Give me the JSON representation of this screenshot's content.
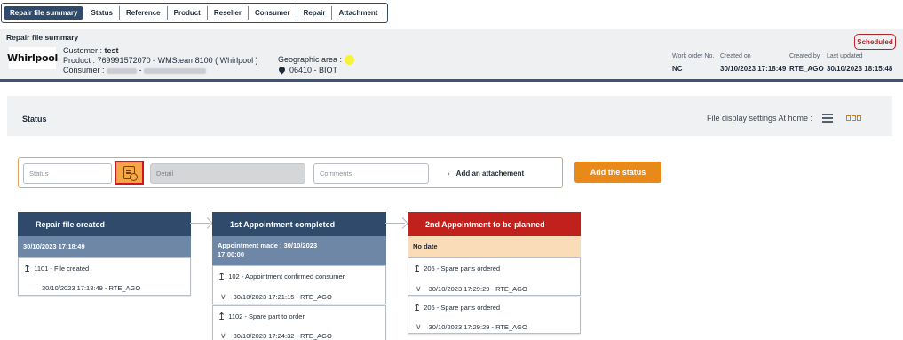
{
  "tabs": [
    {
      "label": "Repair file summary",
      "active": true
    },
    {
      "label": "Status"
    },
    {
      "label": "Reference"
    },
    {
      "label": "Product"
    },
    {
      "label": "Reseller"
    },
    {
      "label": "Consumer"
    },
    {
      "label": "Repair"
    },
    {
      "label": "Attachment"
    }
  ],
  "header": {
    "title": "Repair file summary",
    "brand": "Whirlpool",
    "customer_label": "Customer : ",
    "customer_value": "test",
    "product_label": "Product : ",
    "product_value": "769991572070  -  WMSteam8100 ( Whirlpool )",
    "consumer_label": "Consumer : ",
    "geo_label": "Geographic area :",
    "geo_value": "06410  -  BIOT",
    "status_badge": "Scheduled",
    "meta": {
      "work_order_label": "Work order No.",
      "work_order_value": "NC",
      "created_on_label": "Created on",
      "created_on_value": "30/10/2023 17:18:49",
      "created_by_label": "Created by",
      "created_by_value": "RTE_AGO",
      "last_updated_label": "Last updated",
      "last_updated_value": "30/10/2023 18:15:48"
    }
  },
  "status_section": {
    "title": "Status",
    "display_settings_label": "File display settings At home :",
    "list_icon": "list-icon",
    "grid_icon": "grid-icon"
  },
  "form": {
    "status_placeholder": "Status",
    "detail_placeholder": "Detail",
    "comments_placeholder": "Comments",
    "attach_label": "Add an attachement",
    "add_button": "Add the status"
  },
  "steps": [
    {
      "title": "Repair file created",
      "subtitle": "30/10/2023 17:18:49",
      "colors": {
        "head": "#2f4a6b",
        "sub": "#6f87a7"
      },
      "cards": [
        {
          "code": "1101 - File created",
          "stamp": "30/10/2023 17:18:49  -  RTE_AGO"
        }
      ]
    },
    {
      "title": "1st Appointment completed",
      "subtitle_line1": "Appointment made : 30/10/2023",
      "subtitle_line2": "17:00:00",
      "colors": {
        "head": "#2f4a6b",
        "sub": "#6f87a7"
      },
      "cards": [
        {
          "code": "102 - Appointment confirmed consumer",
          "stamp": "30/10/2023 17:21:15  -  RTE_AGO"
        },
        {
          "code": "1102 - Spare part to order",
          "stamp": "30/10/2023 17:24:32  -  RTE_AGO"
        }
      ]
    },
    {
      "title": "2nd Appointment to be planned",
      "subtitle": "No date",
      "colors": {
        "head": "#c0211c",
        "sub": "#fbdcb9"
      },
      "cards": [
        {
          "code": "205 - Spare parts ordered",
          "stamp": "30/10/2023 17:29:29  -  RTE_AGO"
        },
        {
          "code": "205 - Spare parts ordered",
          "stamp": "30/10/2023 17:29:29  -  RTE_AGO"
        }
      ]
    }
  ]
}
